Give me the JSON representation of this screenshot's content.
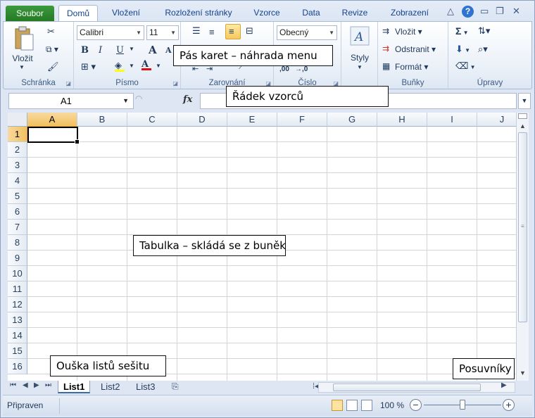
{
  "tabs": {
    "file": "Soubor",
    "items": [
      "Domů",
      "Vložení",
      "Rozložení stránky",
      "Vzorce",
      "Data",
      "Revize",
      "Zobrazení"
    ]
  },
  "ribbon": {
    "clipboard": {
      "label": "Schránka",
      "paste": "Vložit"
    },
    "font": {
      "label": "Písmo",
      "font_name": "Calibri",
      "font_size": "11",
      "bold": "B",
      "italic": "I",
      "underline": "U",
      "grow": "A",
      "shrink": "A"
    },
    "alignment": {
      "label": "Zarovnání"
    },
    "number": {
      "label": "Číslo",
      "format": "Obecný",
      "dec_inc": ",00",
      "dec_dec": "→,0"
    },
    "styles": {
      "label": "Styly"
    },
    "cells": {
      "label": "Buňky",
      "insert": "Vložit",
      "delete": "Odstranit",
      "format": "Formát"
    },
    "editing": {
      "label": "Úpravy",
      "sum": "Σ"
    }
  },
  "formula_bar": {
    "name_box": "A1",
    "fx": "fx"
  },
  "grid": {
    "columns": [
      "A",
      "B",
      "C",
      "D",
      "E",
      "F",
      "G",
      "H",
      "I",
      "J"
    ],
    "rows": [
      "1",
      "2",
      "3",
      "4",
      "5",
      "6",
      "7",
      "8",
      "9",
      "10",
      "11",
      "12",
      "13",
      "14",
      "15",
      "16"
    ]
  },
  "sheets": [
    "List1",
    "List2",
    "List3"
  ],
  "status": {
    "ready": "Připraven",
    "zoom": "100 %",
    "minus": "−",
    "plus": "+"
  },
  "callouts": {
    "ribbon": "Pás karet – náhrada menu",
    "formula": "Řádek vzorců",
    "sheet": "Tabulka – skládá se z buněk",
    "sheet_tabs": "Ouška listů sešitu",
    "scrollbars": "Posuvníky"
  },
  "colors": {
    "file_tab": "#2f8b2f",
    "selection": "#f1c15f",
    "accent": "#15428b"
  }
}
